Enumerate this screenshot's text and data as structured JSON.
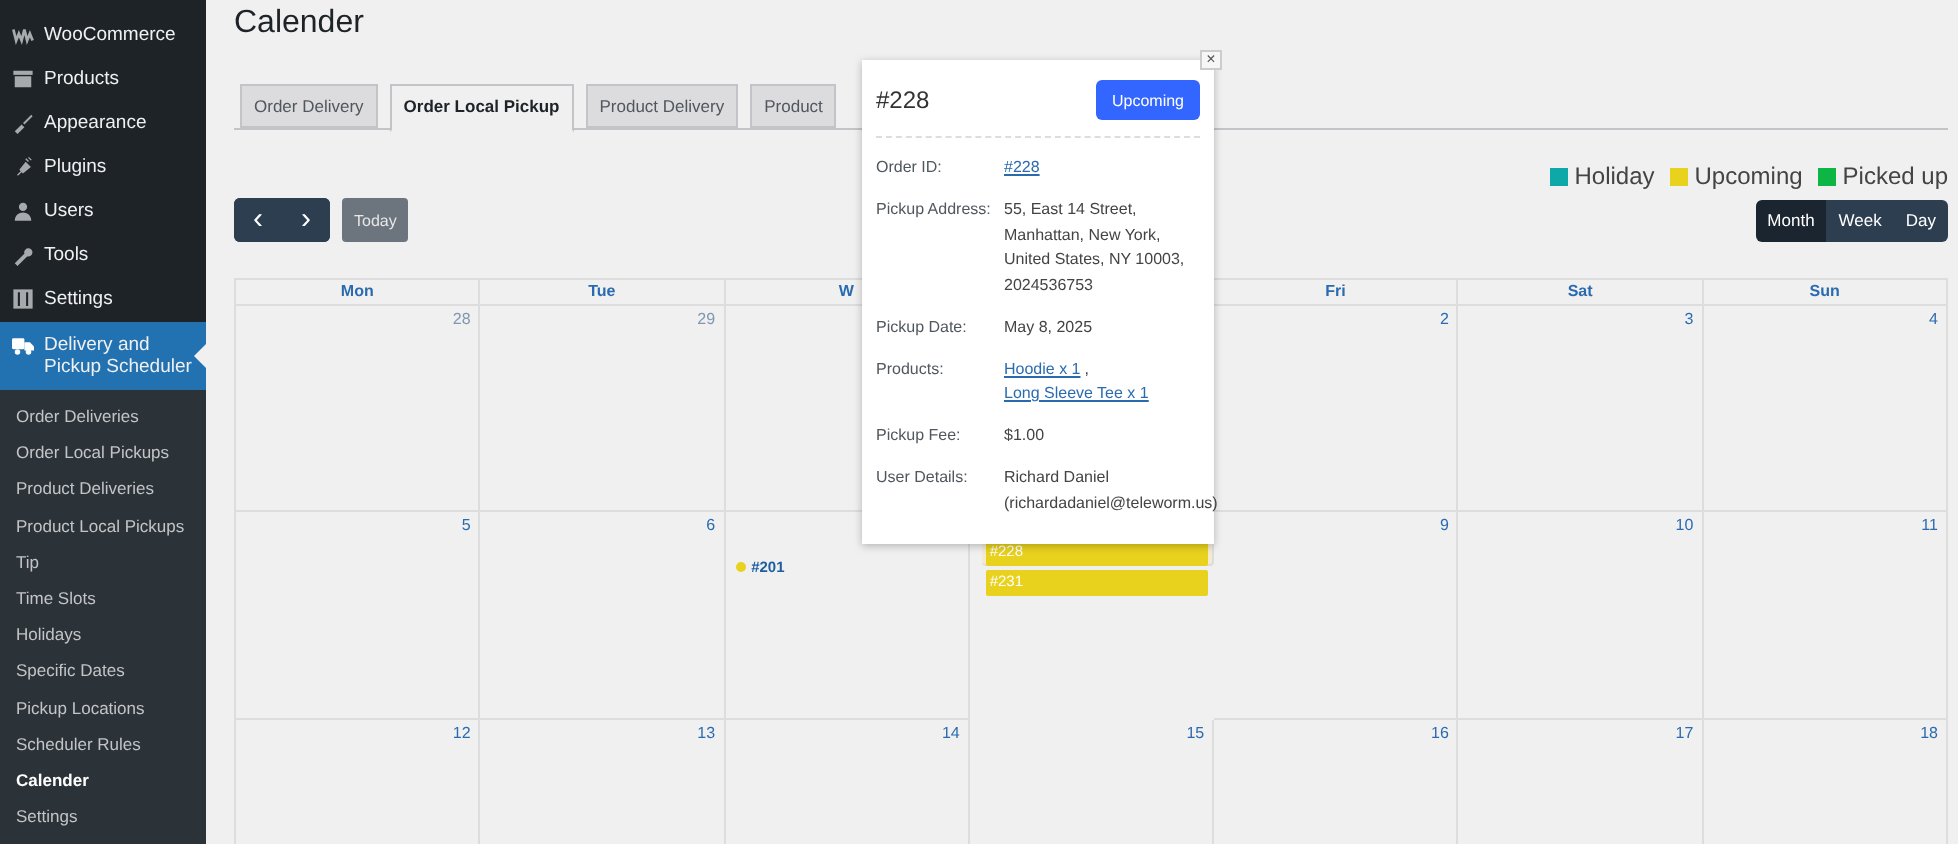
{
  "sidebar": {
    "menu": [
      {
        "label": "WooCommerce",
        "selected": false
      },
      {
        "label": "Products",
        "selected": false
      },
      {
        "label": "Appearance",
        "selected": false
      },
      {
        "label": "Plugins",
        "selected": false
      },
      {
        "label": "Users",
        "selected": false
      },
      {
        "label": "Tools",
        "selected": false
      },
      {
        "label": "Settings",
        "selected": false
      },
      {
        "label": "Delivery and Pickup Scheduler",
        "selected": true
      }
    ],
    "submenu": [
      {
        "label": "Order Deliveries",
        "selected": false
      },
      {
        "label": "Order Local Pickups",
        "selected": false
      },
      {
        "label": "Product Deliveries",
        "selected": false
      },
      {
        "label": "Product Local Pickups",
        "selected": false
      },
      {
        "label": "Tip",
        "selected": false
      },
      {
        "label": "Time Slots",
        "selected": false
      },
      {
        "label": "Holidays",
        "selected": false
      },
      {
        "label": "Specific Dates",
        "selected": false
      },
      {
        "label": "Pickup Locations",
        "selected": false
      },
      {
        "label": "Scheduler Rules",
        "selected": false
      },
      {
        "label": "Calender",
        "selected": true
      },
      {
        "label": "Settings",
        "selected": false
      }
    ]
  },
  "page_title": "Calender",
  "tabs": [
    {
      "label": "Order Delivery",
      "selected": false
    },
    {
      "label": "Order Local Pickup",
      "selected": true
    },
    {
      "label": "Product Delivery",
      "selected": false
    },
    {
      "label": "Product",
      "selected": false
    }
  ],
  "legend": [
    {
      "label": "Holiday",
      "color": "#0fa8a8"
    },
    {
      "label": "Upcoming",
      "color": "#e8d21d"
    },
    {
      "label": "Picked up",
      "color": "#0cb544"
    }
  ],
  "nav": {
    "prev": "‹",
    "next": "›",
    "today": "Today"
  },
  "views": [
    {
      "label": "Month",
      "selected": true
    },
    {
      "label": "Week",
      "selected": false
    },
    {
      "label": "Day",
      "selected": false
    }
  ],
  "calendar": {
    "weekdays": {
      "mon": "Mon",
      "tue": "Tue",
      "wed": "W",
      "fri": "Fri",
      "sat": "Sat",
      "sun": "Sun"
    },
    "weeks": [
      {
        "mon": {
          "day": "28",
          "muted": true
        },
        "tue": {
          "day": "29",
          "muted": true
        },
        "fri": {
          "day": "2",
          "muted": false
        },
        "sat": {
          "day": "3",
          "muted": false
        },
        "sun": {
          "day": "4",
          "muted": false
        }
      },
      {
        "mon": {
          "day": "5",
          "muted": false
        },
        "tue": {
          "day": "6",
          "muted": false
        },
        "wed": {
          "events": [
            {
              "kind": "dot",
              "label": "#201",
              "color": "#e8d21d"
            }
          ]
        },
        "thu": {
          "today": true,
          "events": [
            {
              "kind": "bar",
              "label": "#228",
              "color": "#e8d21d"
            },
            {
              "kind": "bar",
              "label": "#231",
              "color": "#e8d21d"
            }
          ]
        },
        "fri": {
          "day": "9",
          "muted": false
        },
        "sat": {
          "day": "10",
          "muted": false
        },
        "sun": {
          "day": "11",
          "muted": false
        }
      },
      {
        "mon": {
          "day": "12",
          "muted": false
        },
        "tue": {
          "day": "13",
          "muted": false
        },
        "wed": {
          "day": "14",
          "muted": false
        },
        "thu": {
          "day": "15",
          "muted": false
        },
        "fri": {
          "day": "16",
          "muted": false
        },
        "sat": {
          "day": "17",
          "muted": false
        },
        "sun": {
          "day": "18",
          "muted": false
        }
      }
    ]
  },
  "popover": {
    "title": "#228",
    "status": "Upcoming",
    "close": "×",
    "fields": [
      {
        "label": "Order ID:",
        "kind": "links",
        "links": [
          "#228"
        ]
      },
      {
        "label": "Pickup Address:",
        "kind": "text",
        "value": "55, East 14 Street, Manhattan, New York, United States, NY 10003, 2024536753"
      },
      {
        "label": "Pickup Date:",
        "kind": "text",
        "value": "May 8, 2025"
      },
      {
        "label": "Products:",
        "kind": "links",
        "links": [
          "Hoodie x 1",
          "Long Sleeve Tee x 1"
        ],
        "separator": ","
      },
      {
        "label": "Pickup Fee:",
        "kind": "text",
        "value": "$1.00"
      },
      {
        "label": "User Details:",
        "kind": "text",
        "value": "Richard Daniel (richardadaniel@teleworm.us)"
      }
    ]
  }
}
